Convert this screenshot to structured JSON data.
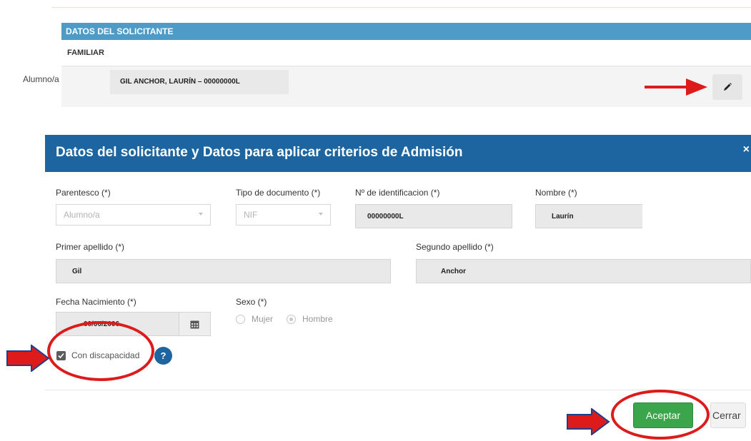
{
  "solicitante": {
    "header": "DATOS DEL SOLICITANTE",
    "subheader": "FAMILIAR",
    "alumno_label": "Alumno/a",
    "alumno_value": "GIL ANCHOR, LAURÍN – 00000000L",
    "edit_icon": "pencil-icon"
  },
  "modal": {
    "title": "Datos del solicitante y Datos para aplicar criterios de Admisión",
    "close": "×",
    "fields": {
      "parentesco_label": "Parentesco (*)",
      "parentesco_value": "Alumno/a",
      "tipo_doc_label": "Tipo de documento (*)",
      "tipo_doc_value": "NIF",
      "num_id_label": "Nº de identificacion (*)",
      "num_id_value": "00000000L",
      "nombre_label": "Nombre (*)",
      "nombre_value": "Laurín",
      "primer_apellido_label": "Primer apellido (*)",
      "primer_apellido_value": "Gil",
      "segundo_apellido_label": "Segundo apellido (*)",
      "segundo_apellido_value": "Anchor",
      "fecha_label": "Fecha Nacimiento (*)",
      "fecha_value": "00/00/2006",
      "sexo_label": "Sexo (*)",
      "sexo_mujer": "Mujer",
      "sexo_hombre": "Hombre",
      "discapacidad_label": "Con discapacidad",
      "discapacidad_checked": true,
      "help": "?"
    },
    "buttons": {
      "aceptar": "Aceptar",
      "cerrar": "Cerrar"
    }
  },
  "colors": {
    "section_header": "#4d9bc6",
    "modal_header": "#1d65a1",
    "accept_button": "#3aa54a",
    "annotation": "#dd1b1b"
  }
}
